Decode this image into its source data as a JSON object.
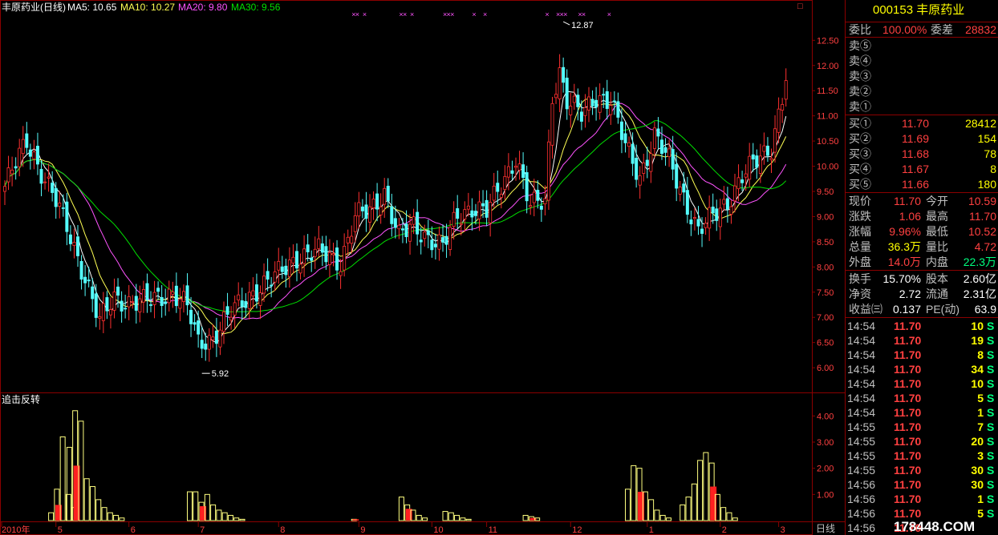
{
  "legend": {
    "name": "丰原药业(日线)",
    "ma5": "MA5: 10.65",
    "ma10": "MA10: 10.27",
    "ma20": "MA20: 9.80",
    "ma30": "MA30: 9.56"
  },
  "colors": {
    "up": "#ff3030",
    "down": "#54fcfc",
    "ma5": "#ffffff",
    "ma10": "#ffff54",
    "ma20": "#ff54ff",
    "ma30": "#00e000",
    "grid": "#8b0000",
    "axisText": "#ff4040",
    "volBar": "#ffff80",
    "volFill": "#ff2020",
    "marker": "#ff54ff"
  },
  "labels": {
    "max": "12.87",
    "min": "5.92",
    "indicator": "追击反转",
    "period": "日线",
    "corner": "□"
  },
  "panel": {
    "title": "000153 丰原药业",
    "weibi_label": "委比",
    "weibi": "100.00%",
    "weicha_label": "委差",
    "weicha": "28832",
    "sells": [
      {
        "label": "卖⑤"
      },
      {
        "label": "卖④"
      },
      {
        "label": "卖③"
      },
      {
        "label": "卖②"
      },
      {
        "label": "卖①"
      }
    ],
    "buys": [
      {
        "label": "买①",
        "price": "11.70",
        "vol": "28412"
      },
      {
        "label": "买②",
        "price": "11.69",
        "vol": "154"
      },
      {
        "label": "买③",
        "price": "11.68",
        "vol": "78"
      },
      {
        "label": "买④",
        "price": "11.67",
        "vol": "8"
      },
      {
        "label": "买⑤",
        "price": "11.66",
        "vol": "180"
      }
    ],
    "stats": [
      {
        "l1": "现价",
        "v1": "11.70",
        "c1": "red",
        "l2": "今开",
        "v2": "10.59",
        "c2": "red"
      },
      {
        "l1": "涨跌",
        "v1": "1.06",
        "c1": "red",
        "l2": "最高",
        "v2": "11.70",
        "c2": "red"
      },
      {
        "l1": "涨幅",
        "v1": "9.96%",
        "c1": "red",
        "l2": "最低",
        "v2": "10.52",
        "c2": "red"
      },
      {
        "l1": "总量",
        "v1": "36.3万",
        "c1": "yel",
        "l2": "量比",
        "v2": "4.72",
        "c2": "red"
      },
      {
        "l1": "外盘",
        "v1": "14.0万",
        "c1": "red",
        "l2": "内盘",
        "v2": "22.3万",
        "c2": "grn"
      },
      {
        "l1": "换手",
        "v1": "15.70%",
        "c1": "wht",
        "l2": "股本",
        "v2": "2.60亿",
        "c2": "wht"
      },
      {
        "l1": "净资",
        "v1": "2.72",
        "c1": "wht",
        "l2": "流通",
        "v2": "2.31亿",
        "c2": "wht"
      },
      {
        "l1": "收益㈢",
        "v1": "0.137",
        "c1": "wht",
        "l2": "PE(动)",
        "v2": "63.9",
        "c2": "wht"
      }
    ],
    "ticks": [
      {
        "time": "14:54",
        "price": "11.70",
        "vol": "10",
        "side": "S"
      },
      {
        "time": "14:54",
        "price": "11.70",
        "vol": "19",
        "side": "S"
      },
      {
        "time": "14:54",
        "price": "11.70",
        "vol": "8",
        "side": "S"
      },
      {
        "time": "14:54",
        "price": "11.70",
        "vol": "34",
        "side": "S"
      },
      {
        "time": "14:54",
        "price": "11.70",
        "vol": "10",
        "side": "S"
      },
      {
        "time": "14:54",
        "price": "11.70",
        "vol": "5",
        "side": "S"
      },
      {
        "time": "14:54",
        "price": "11.70",
        "vol": "1",
        "side": "S"
      },
      {
        "time": "14:55",
        "price": "11.70",
        "vol": "7",
        "side": "S"
      },
      {
        "time": "14:55",
        "price": "11.70",
        "vol": "20",
        "side": "S"
      },
      {
        "time": "14:55",
        "price": "11.70",
        "vol": "3",
        "side": "S"
      },
      {
        "time": "14:55",
        "price": "11.70",
        "vol": "30",
        "side": "S"
      },
      {
        "time": "14:56",
        "price": "11.70",
        "vol": "30",
        "side": "S"
      },
      {
        "time": "14:56",
        "price": "11.70",
        "vol": "1",
        "side": "S"
      },
      {
        "time": "14:56",
        "price": "11.70",
        "vol": "5",
        "side": "S"
      },
      {
        "time": "14:56",
        "price": "11.70",
        "vol": "",
        "side": ""
      }
    ],
    "watermark": "178448.COM"
  },
  "chart_data": {
    "type": "candlestick",
    "price_axis": {
      "ticks": [
        "12.50",
        "12.00",
        "11.50",
        "11.00",
        "10.50",
        "10.00",
        "9.50",
        "9.00",
        "8.50",
        "8.00",
        "7.50",
        "7.00",
        "6.50",
        "6.00"
      ],
      "range": [
        5.7,
        12.95
      ]
    },
    "indicator_axis": {
      "ticks": [
        "4.00",
        "3.00",
        "2.00",
        "1.00"
      ],
      "range": [
        0,
        4.5
      ]
    },
    "x_ticks": [
      {
        "label": "2010年",
        "day": 0
      },
      {
        "label": "5",
        "day": 14
      },
      {
        "label": "6",
        "day": 34
      },
      {
        "label": "7",
        "day": 53
      },
      {
        "label": "8",
        "day": 75
      },
      {
        "label": "9",
        "day": 97
      },
      {
        "label": "10",
        "day": 117
      },
      {
        "label": "11",
        "day": 132
      },
      {
        "label": "12",
        "day": 155
      },
      {
        "label": "1",
        "day": 176
      },
      {
        "label": "2",
        "day": 196
      },
      {
        "label": "3",
        "day": 212
      }
    ],
    "close_path": [
      [
        0,
        9.6
      ],
      [
        6,
        10.5
      ],
      [
        10,
        9.9
      ],
      [
        14,
        9.3
      ],
      [
        18,
        8.6
      ],
      [
        22,
        7.8
      ],
      [
        26,
        6.9
      ],
      [
        30,
        7.4
      ],
      [
        34,
        7.3
      ],
      [
        38,
        7.3
      ],
      [
        42,
        7.4
      ],
      [
        46,
        7.5
      ],
      [
        50,
        7.2
      ],
      [
        53,
        6.5
      ],
      [
        57,
        6.6
      ],
      [
        62,
        7.1
      ],
      [
        68,
        7.5
      ],
      [
        74,
        7.8
      ],
      [
        80,
        8.2
      ],
      [
        86,
        8.3
      ],
      [
        92,
        8.1
      ],
      [
        96,
        9.0
      ],
      [
        100,
        9.1
      ],
      [
        104,
        9.5
      ],
      [
        108,
        8.6
      ],
      [
        112,
        8.8
      ],
      [
        116,
        8.6
      ],
      [
        120,
        8.4
      ],
      [
        124,
        9.0
      ],
      [
        128,
        9.2
      ],
      [
        132,
        9.1
      ],
      [
        136,
        9.6
      ],
      [
        140,
        10.2
      ],
      [
        144,
        9.2
      ],
      [
        148,
        9.3
      ],
      [
        150,
        11.4
      ],
      [
        152,
        11.9
      ],
      [
        154,
        11.3
      ],
      [
        158,
        11.0
      ],
      [
        162,
        11.4
      ],
      [
        166,
        11.3
      ],
      [
        170,
        10.4
      ],
      [
        174,
        9.8
      ],
      [
        178,
        10.6
      ],
      [
        182,
        10.1
      ],
      [
        186,
        9.4
      ],
      [
        190,
        8.7
      ],
      [
        194,
        9.0
      ],
      [
        198,
        9.3
      ],
      [
        202,
        9.8
      ],
      [
        206,
        10.1
      ],
      [
        210,
        10.4
      ],
      [
        214,
        11.7
      ]
    ],
    "max_label": {
      "value": 12.87,
      "day": 153
    },
    "min_label": {
      "value": 5.92,
      "day": 54
    },
    "markers_days": [
      95,
      96,
      98,
      108,
      109,
      111,
      120,
      121,
      122,
      128,
      131,
      148,
      151,
      152,
      153,
      157,
      158,
      165
    ],
    "indicator_groups": [
      {
        "start": 12,
        "bars": [
          0.3,
          1.2,
          3.2,
          1.0,
          0.5
        ],
        "fills": [
          0,
          0.6,
          0,
          0,
          0
        ]
      },
      {
        "start": 17,
        "bars": [
          2.8,
          4.2,
          3.8,
          1.6,
          1.3,
          0.8,
          0.5,
          0.3,
          0.2,
          0.1
        ],
        "fills": [
          0,
          2.1,
          0,
          0,
          0,
          0,
          0,
          0,
          0,
          0
        ]
      },
      {
        "start": 50,
        "bars": [
          1.1,
          1.1,
          0.7,
          1.0,
          0.6,
          0.4,
          0.3,
          0.2,
          0.1,
          0.05
        ],
        "fills": [
          0,
          0,
          0.55,
          0,
          0,
          0,
          0,
          0,
          0,
          0
        ]
      },
      {
        "start": 95,
        "bars": [
          0.05
        ],
        "fills": [
          0.05
        ]
      },
      {
        "start": 108,
        "bars": [
          0.9,
          0.6,
          0.4,
          0.2,
          0.1
        ],
        "fills": [
          0,
          0.45,
          0,
          0,
          0
        ]
      },
      {
        "start": 120,
        "bars": [
          0.35,
          0.3,
          0.2,
          0.1,
          0.05
        ],
        "fills": [
          0,
          0,
          0,
          0,
          0
        ]
      },
      {
        "start": 142,
        "bars": [
          0.2,
          0.15,
          0.1
        ],
        "fills": [
          0,
          0.1,
          0
        ]
      },
      {
        "start": 170,
        "bars": [
          1.2,
          2.1,
          2.0,
          1.1,
          0.8,
          0.4,
          0.2,
          0.1
        ],
        "fills": [
          0,
          0,
          1.1,
          0,
          0,
          0,
          0,
          0
        ]
      },
      {
        "start": 185,
        "bars": [
          0.6,
          0.9,
          1.4,
          2.3,
          2.6,
          2.2,
          1.0,
          0.5,
          0.3,
          0.1
        ],
        "fills": [
          0,
          0,
          0,
          0,
          0,
          1.3,
          0,
          0,
          0,
          0
        ]
      }
    ]
  }
}
